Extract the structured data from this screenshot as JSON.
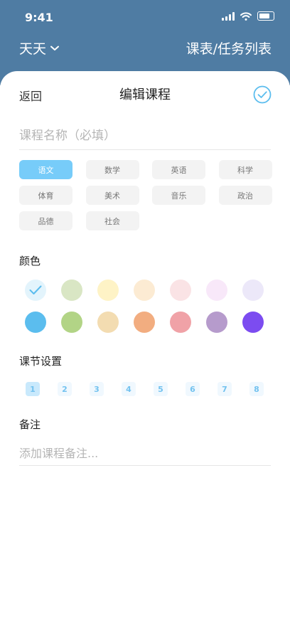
{
  "status_bar": {
    "time": "9:41"
  },
  "header": {
    "user": "天天",
    "right_link": "课表/任务列表"
  },
  "sheet": {
    "back_label": "返回",
    "title": "编辑课程"
  },
  "course_name": {
    "placeholder": "课程名称（必填）",
    "value": ""
  },
  "subjects": [
    {
      "label": "语文",
      "selected": true
    },
    {
      "label": "数学",
      "selected": false
    },
    {
      "label": "英语",
      "selected": false
    },
    {
      "label": "科学",
      "selected": false
    },
    {
      "label": "体育",
      "selected": false
    },
    {
      "label": "美术",
      "selected": false
    },
    {
      "label": "音乐",
      "selected": false
    },
    {
      "label": "政治",
      "selected": false
    },
    {
      "label": "品德",
      "selected": false
    },
    {
      "label": "社会",
      "selected": false
    }
  ],
  "color_section": {
    "label": "颜色",
    "selected_index": 0,
    "colors": [
      "#e3f4fc",
      "#d9e6c4",
      "#fef3c6",
      "#fcebd3",
      "#fae3e5",
      "#f8e8f9",
      "#ece8f9",
      "#5bbdee",
      "#b2d486",
      "#f3dcb1",
      "#f2ad80",
      "#f0a2a7",
      "#b69bcc",
      "#7c4cf0"
    ]
  },
  "period_section": {
    "label": "课节设置",
    "periods": [
      "1",
      "2",
      "3",
      "4",
      "5",
      "6",
      "7",
      "8"
    ],
    "selected": "1"
  },
  "note_section": {
    "label": "备注",
    "placeholder": "添加课程备注...",
    "value": ""
  },
  "accent": "#5bbdee",
  "header_bg": "#4f7ca3"
}
